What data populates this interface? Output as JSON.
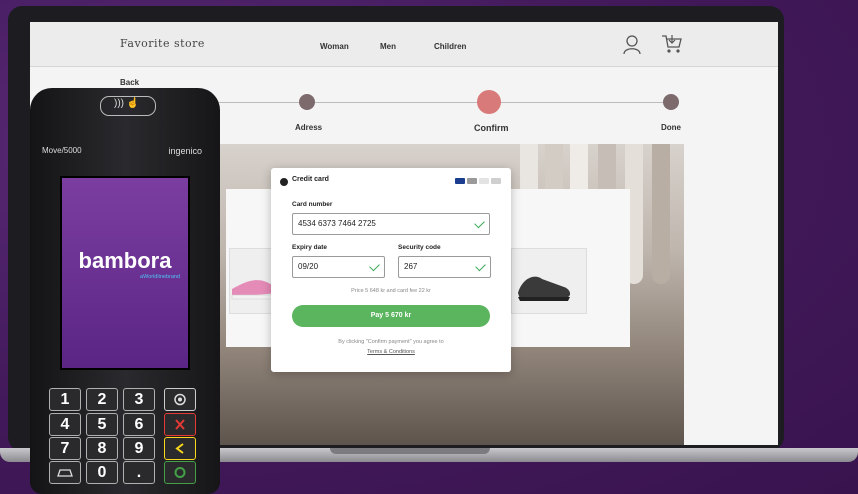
{
  "store": {
    "logo": "Favorite store",
    "nav": [
      "Woman",
      "Men",
      "Children"
    ]
  },
  "checkout": {
    "back_label": "Back",
    "steps": [
      "Adress",
      "Confirm",
      "Done"
    ]
  },
  "payment": {
    "method": "Credit card",
    "card_number_label": "Card number",
    "card_number": "4534 6373 7464 2725",
    "expiry_label": "Expiry date",
    "expiry": "09/20",
    "security_label": "Security code",
    "security": "267",
    "price_note": "Price 5 648 kr and card fee 22 kr",
    "pay_button": "Pay 5 670 kr",
    "terms_line": "By clicking \"Confirm payment\" you agree to",
    "terms_link": "Terms & Conditions"
  },
  "terminal": {
    "model": "Move/5000",
    "brand": "ingenico",
    "screen_title": "bambora",
    "screen_sub": "aWorldlinebrand",
    "keys": [
      "1",
      "2",
      "3",
      "4",
      "5",
      "6",
      "7",
      "8",
      "9",
      "0",
      "."
    ]
  },
  "colors": {
    "background": "#4a2163",
    "pay_button": "#5ab55e",
    "confirm_step": "#d97a7a",
    "terminal_screen": "#6a2f92"
  }
}
